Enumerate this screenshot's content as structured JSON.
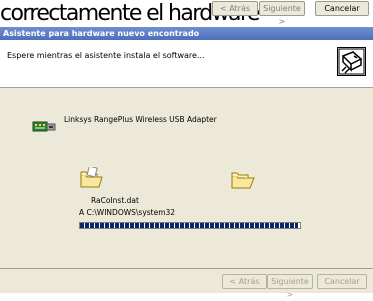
{
  "previous_window": {
    "ghost_text": "correctamente el hardware",
    "buttons": {
      "back": "< Atrás",
      "next": "Siguiente >",
      "cancel": "Cancelar"
    }
  },
  "window": {
    "title": "Asistente para hardware nuevo encontrado"
  },
  "header": {
    "message": "Espere mientras el asistente instala el software...",
    "icon": "hardware-wizard-icon"
  },
  "device": {
    "icon": "usb-adapter-icon",
    "name": "Linksys RangePlus Wireless USB Adapter"
  },
  "copy": {
    "file_name": "RaCoInst.dat",
    "destination": "A C:\\WINDOWS\\system32",
    "progress_fraction": 0.99
  },
  "footer": {
    "back_label": "< Atrás",
    "next_label": "Siguiente >",
    "cancel_label": "Cancelar"
  },
  "colors": {
    "titlebar": "#4d6fba",
    "dialog_bg": "#ece9d8",
    "progress": "#0a246a"
  }
}
